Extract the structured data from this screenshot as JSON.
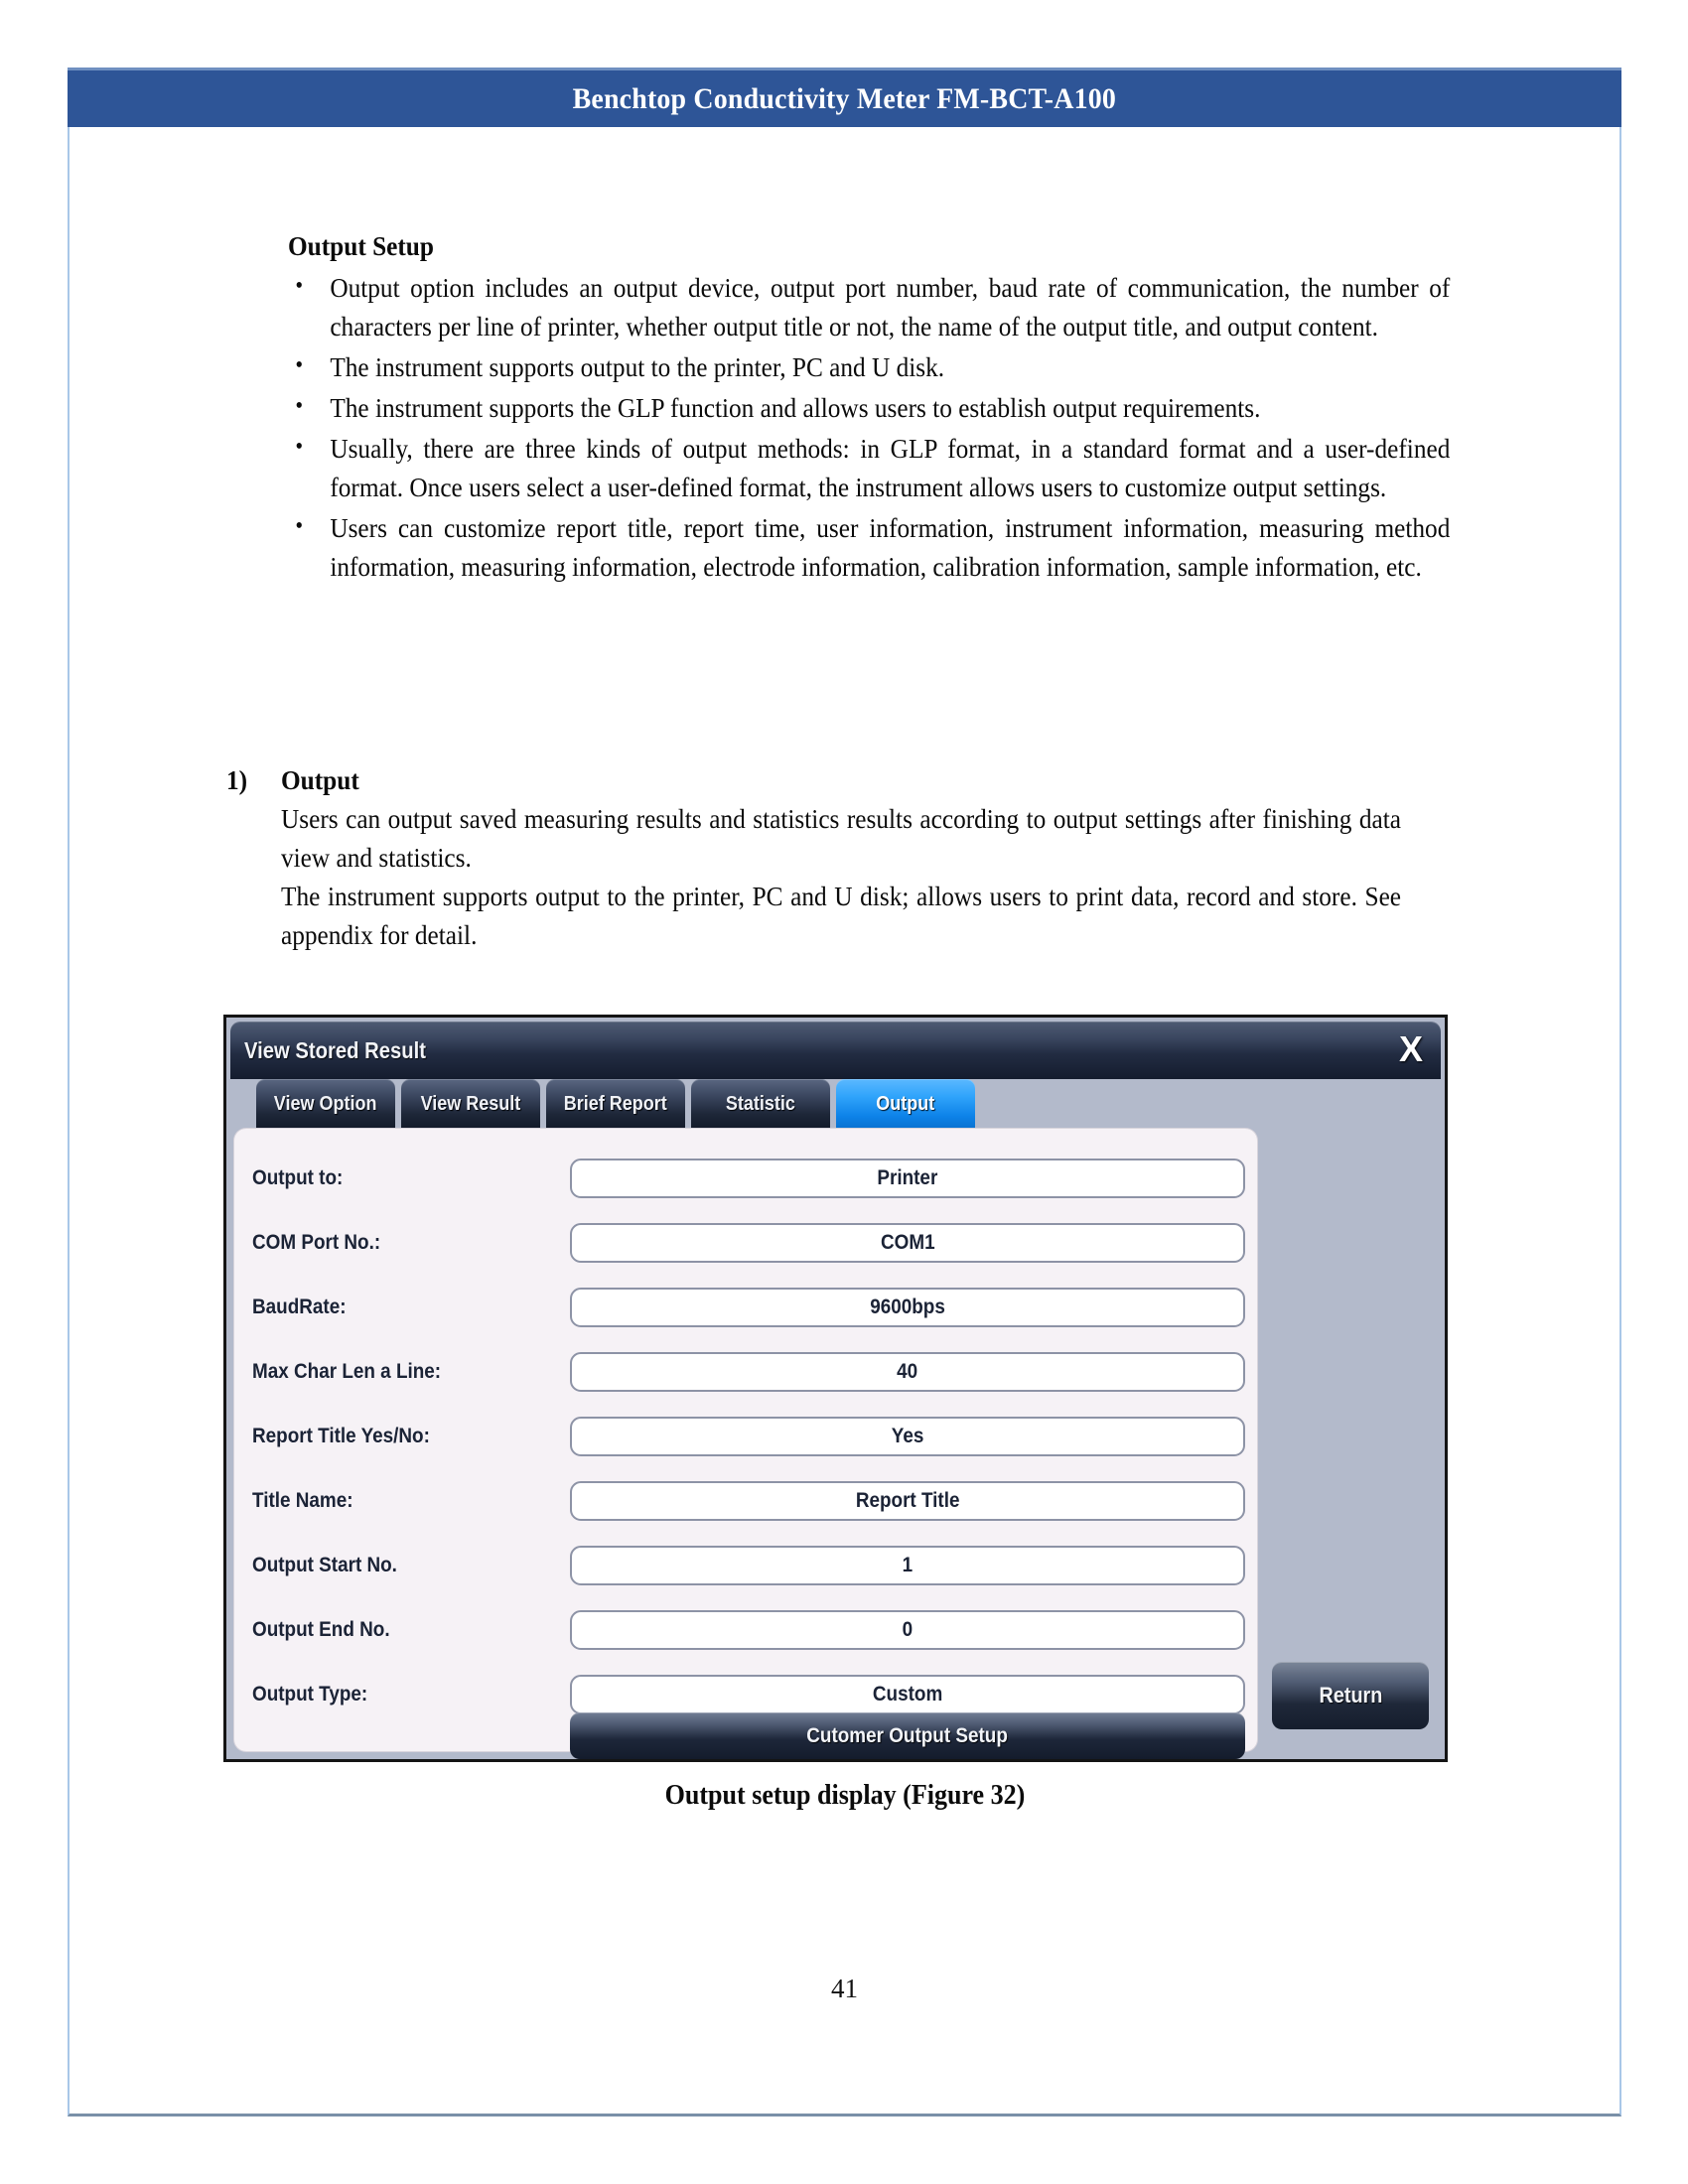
{
  "header": {
    "title": "Benchtop Conductivity Meter FM-BCT-A100"
  },
  "body": {
    "section_heading": "Output Setup",
    "bullets": [
      "Output option includes an output device, output port number, baud rate of communication, the number of characters per line of printer, whether output title or not, the name of the output title, and output content.",
      "The instrument supports output to the printer, PC and U disk.",
      "The instrument supports the GLP function and allows users to establish output requirements.",
      "Usually, there are three kinds of output methods: in GLP format, in a standard format and a user-defined format. Once users select a user-defined format, the instrument allows users to customize output settings.",
      "Users can customize report title, report time, user information, instrument information, measuring method information, measuring information, electrode information, calibration information, sample information, etc."
    ],
    "numbered_section": {
      "marker": "1)",
      "heading": "Output",
      "paragraphs": [
        "Users can output saved measuring results and statistics results according to output settings after finishing data view and statistics.",
        "The instrument supports output to the printer, PC and U disk; allows users to print data, record and store. See appendix for detail."
      ]
    }
  },
  "device_dialog": {
    "window_title": "View Stored Result",
    "close_icon": "X",
    "tabs": [
      {
        "label": "View Option",
        "active": false
      },
      {
        "label": "View Result",
        "active": false
      },
      {
        "label": "Brief Report",
        "active": false
      },
      {
        "label": "Statistic",
        "active": false
      },
      {
        "label": "Output",
        "active": true
      }
    ],
    "fields": [
      {
        "label": "Output to:",
        "value": "Printer"
      },
      {
        "label": "COM Port No.:",
        "value": "COM1"
      },
      {
        "label": "BaudRate:",
        "value": "9600bps"
      },
      {
        "label": "Max Char Len a Line:",
        "value": "40"
      },
      {
        "label": "Report Title Yes/No:",
        "value": "Yes"
      },
      {
        "label": "Title Name:",
        "value": "Report Title"
      },
      {
        "label": "Output Start No.",
        "value": "1"
      },
      {
        "label": "Output End No.",
        "value": "0"
      },
      {
        "label": "Output Type:",
        "value": "Custom"
      }
    ],
    "customer_setup_button": "Cutomer Output Setup",
    "return_button": "Return",
    "accent_color": "#0d82e8"
  },
  "figure_caption": "Output setup display (Figure 32)",
  "page_number": "41"
}
